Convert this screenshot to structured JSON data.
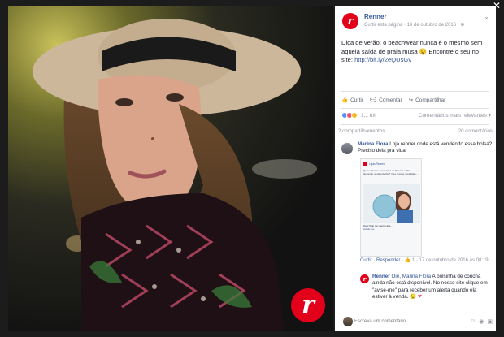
{
  "post": {
    "page_name": "Renner",
    "follow_label": "Curtir esta página",
    "date": "16 de outubro de 2016",
    "text": "Dica de verão: o beachwear nunca é o mesmo sem aquela saída de praia musa 😉 Encontre o seu no site:",
    "url": "http://bit.ly/2eQUsGv",
    "actions": {
      "like": "Curtir",
      "comment": "Comentar",
      "share": "Compartilhar"
    },
    "reaction_count": "1,1 mil",
    "relevance": "Comentários mais relevantes ▾",
    "shares": "2 compartilhamentos",
    "comments_count": "20 comentários"
  },
  "comments": [
    {
      "author": "Marina Flora",
      "text": "Loja renner onde está vendendo essa bolsa? Preciso dela pra vida!",
      "like_label": "Curtir",
      "reply_label": "Responder",
      "likes": "1",
      "date": "17 de outubro de 2016 às 08:19"
    },
    {
      "author": "Renner",
      "mention": "Oiê, Marina Flora",
      "text": "A bolsinha de concha ainda não está disponível. No nosso site clique em \"avise-me\" para receber um alerta quando ela estiver à venda. 😉",
      "emoji": "❤"
    }
  ],
  "embed": {
    "title": "Lojas Renner",
    "subtitle": "outubro de 2016",
    "text": "Quer saber os acessórios de Renner estão lançando nesta coleção? Veja nossas novidades...",
    "footer_title": "Quer ficar por dentro das...",
    "footer_sub": "Avisar-me"
  },
  "reply_placeholder": "Escreva um comentário...",
  "colors": {
    "brand": "#e3001b",
    "link": "#365899",
    "like_blue": "#5890ff",
    "heart_red": "#f25268",
    "haha_yellow": "#f7b928"
  }
}
